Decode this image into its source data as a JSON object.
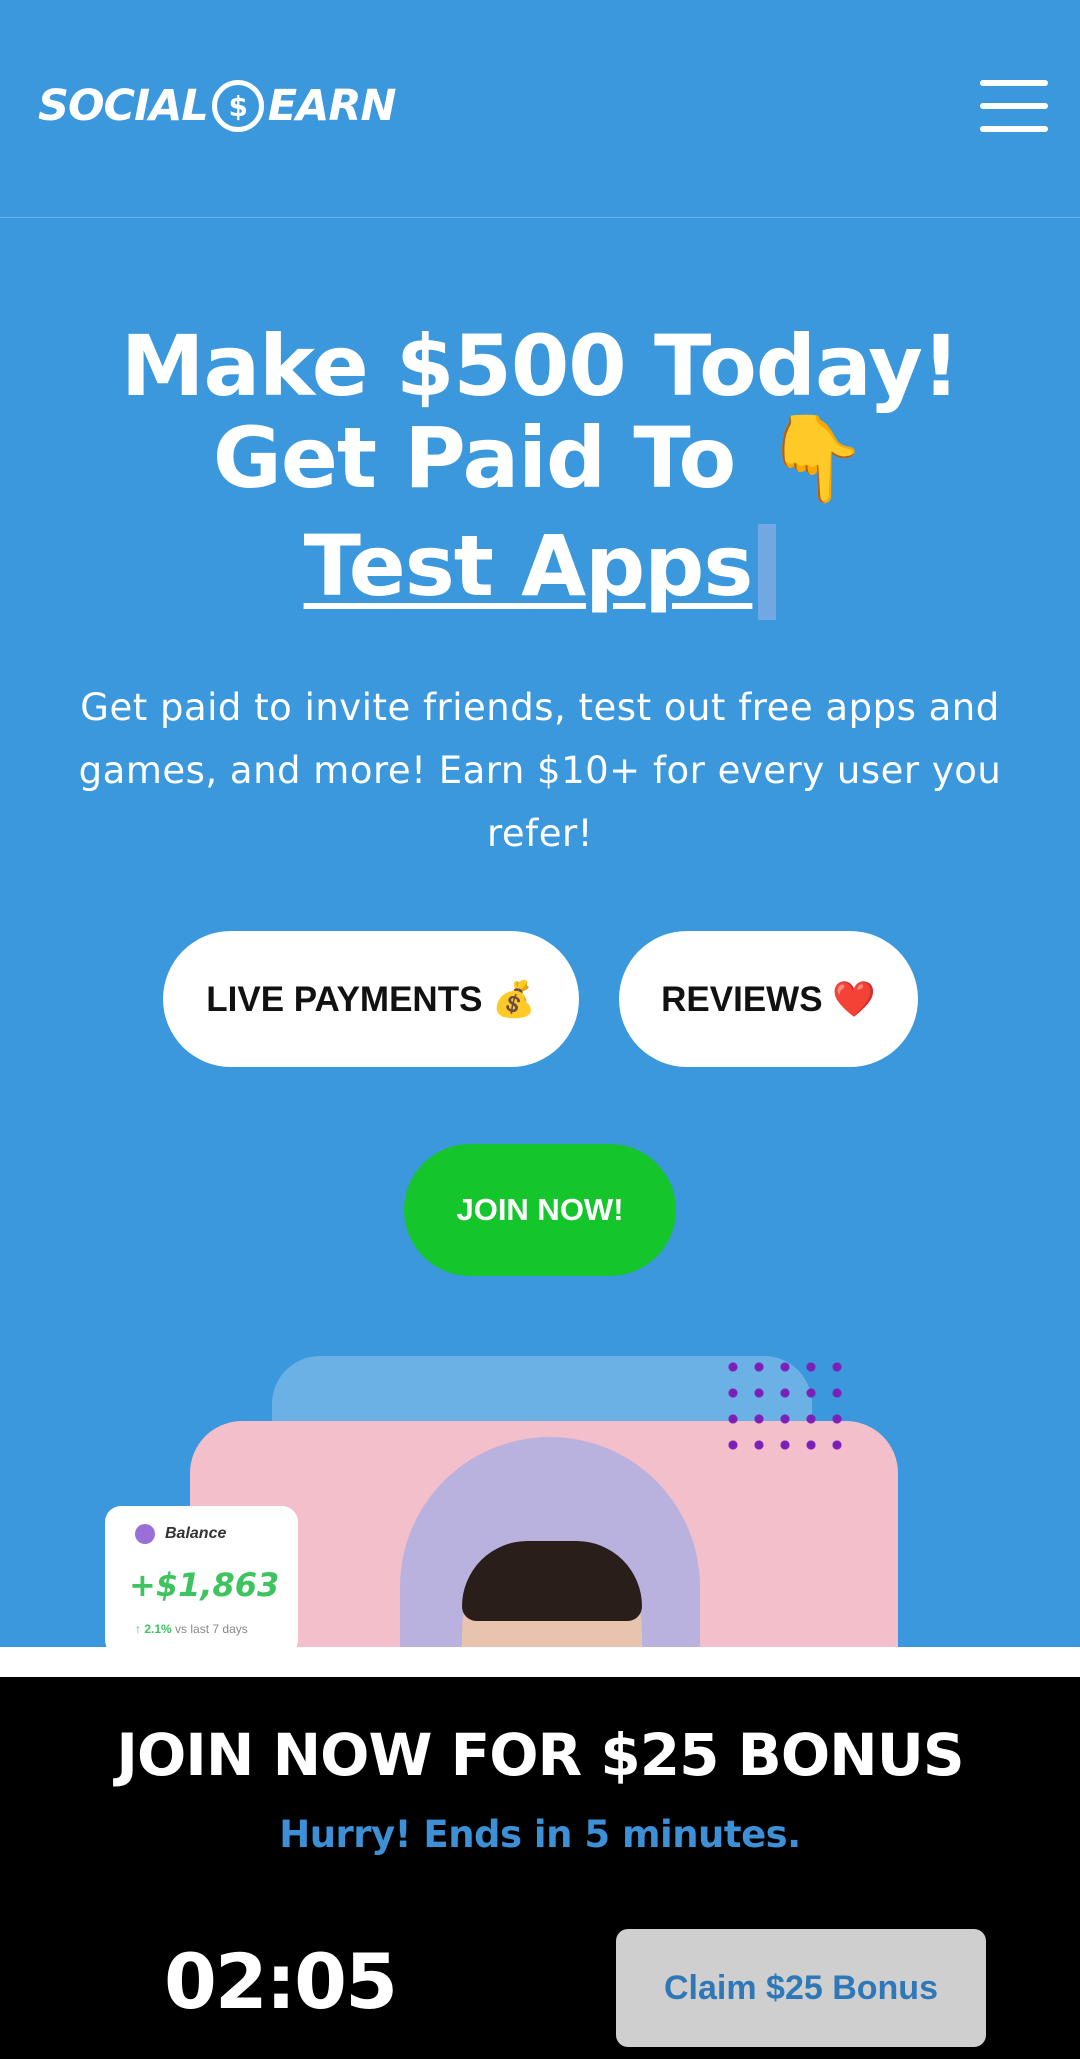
{
  "header": {
    "logo_part1": "SOCIAL",
    "logo_coin": "$",
    "logo_part2": "EARN",
    "menu_icon": "hamburger-menu-icon"
  },
  "hero": {
    "title_line1": "Make $500 Today!",
    "title_line2": "Get Paid To 👇",
    "title_line3": "Test Apps",
    "description": "Get paid to invite friends, test out free apps and games, and more! Earn $10+ for every user you refer!"
  },
  "buttons": {
    "live_payments": "LIVE PAYMENTS 💰",
    "reviews": "REVIEWS ❤️",
    "join_now": "JOIN NOW!"
  },
  "balance_card": {
    "label": "Balance",
    "amount": "+$1,863",
    "change_arrow": "↑",
    "change_pct": "2.1%",
    "change_text": "vs last 7 days"
  },
  "promo": {
    "title": "JOIN NOW FOR $25 BONUS",
    "subtitle": "Hurry! Ends in 5 minutes.",
    "timer": "02:05",
    "claim_label": "Claim $25 Bonus"
  },
  "colors": {
    "background": "#3b98dc",
    "join_green": "#14c52b",
    "promo_blue": "#3d8fd6",
    "balance_green": "#3dc45f"
  }
}
